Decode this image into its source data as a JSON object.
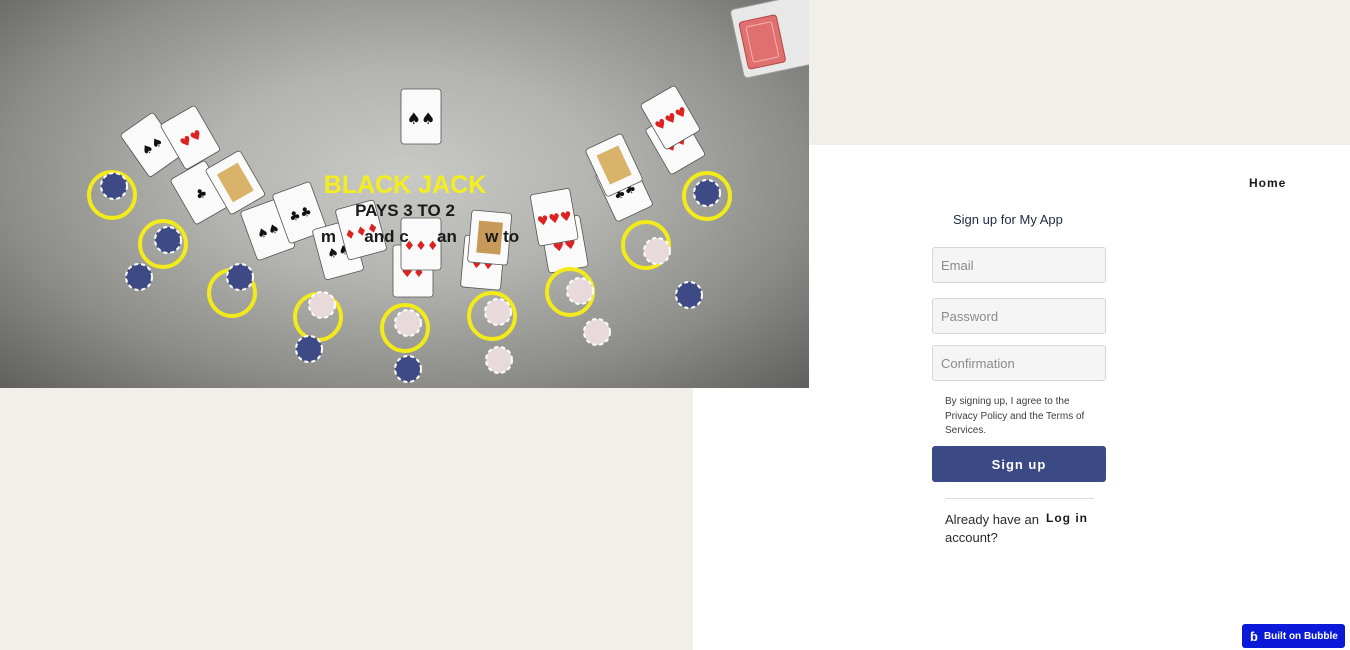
{
  "hero": {
    "title": "BLACK JACK",
    "subtitle": "PAYS 3 TO 2",
    "line3": "m      and c      an      w to"
  },
  "nav": {
    "home_label": "Home"
  },
  "signup": {
    "title": "Sign up for My App",
    "email_placeholder": "Email",
    "password_placeholder": "Password",
    "confirmation_placeholder": "Confirmation",
    "terms_text": "By signing up, I agree to the Privacy Policy and the Terms of Services.",
    "button_label": "Sign up",
    "already_text": "Already have an account?",
    "login_label": "Log in"
  },
  "badge": {
    "label": "Built on Bubble",
    "icon": "bubble-logo-icon"
  },
  "colors": {
    "accent": "#3b4a85",
    "beige": "#f2efea",
    "badge": "#0a1ad8",
    "table_text": "#f5ee1e"
  }
}
